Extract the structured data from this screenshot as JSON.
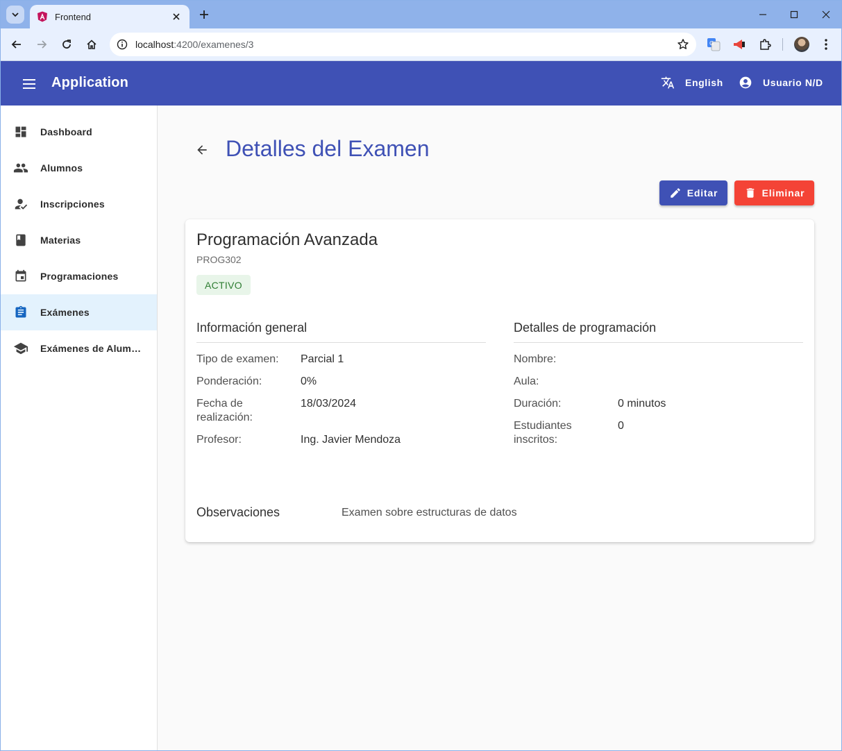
{
  "browser": {
    "tab_title": "Frontend",
    "url_host": "localhost",
    "url_path": ":4200/examenes/3"
  },
  "app": {
    "title": "Application",
    "language": "English",
    "user": "Usuario N/D"
  },
  "sidebar": {
    "items": [
      {
        "label": "Dashboard",
        "icon": "dashboard-icon",
        "active": false
      },
      {
        "label": "Alumnos",
        "icon": "people-icon",
        "active": false
      },
      {
        "label": "Inscripciones",
        "icon": "how-to-reg-icon",
        "active": false
      },
      {
        "label": "Materias",
        "icon": "book-icon",
        "active": false
      },
      {
        "label": "Programaciones",
        "icon": "calendar-icon",
        "active": false
      },
      {
        "label": "Exámenes",
        "icon": "assignment-icon",
        "active": true
      },
      {
        "label": "Exámenes de Alumnos",
        "icon": "school-icon",
        "active": false
      }
    ]
  },
  "page": {
    "title": "Detalles del Examen",
    "edit_label": "Editar",
    "delete_label": "Eliminar"
  },
  "exam": {
    "name": "Programación Avanzada",
    "code": "PROG302",
    "status": "ACTIVO"
  },
  "general": {
    "title": "Información general",
    "rows": [
      {
        "label": "Tipo de examen:",
        "value": "Parcial 1"
      },
      {
        "label": "Ponderación:",
        "value": "0%"
      },
      {
        "label": "Fecha de realización:",
        "value": "18/03/2024"
      },
      {
        "label": "Profesor:",
        "value": "Ing. Javier Mendoza"
      }
    ]
  },
  "programming": {
    "title": "Detalles de programación",
    "rows": [
      {
        "label": "Nombre:",
        "value": ""
      },
      {
        "label": "Aula:",
        "value": ""
      },
      {
        "label": "Duración:",
        "value": "0 minutos"
      },
      {
        "label": "Estudiantes inscritos:",
        "value": "0"
      }
    ]
  },
  "observations": {
    "title": "Observaciones",
    "text": "Examen sobre estructuras de datos"
  },
  "colors": {
    "primary": "#3f51b5",
    "danger": "#f44336",
    "active_bg": "#e3f2fd",
    "status_bg": "#e8f5e9",
    "status_fg": "#2e7d32"
  }
}
